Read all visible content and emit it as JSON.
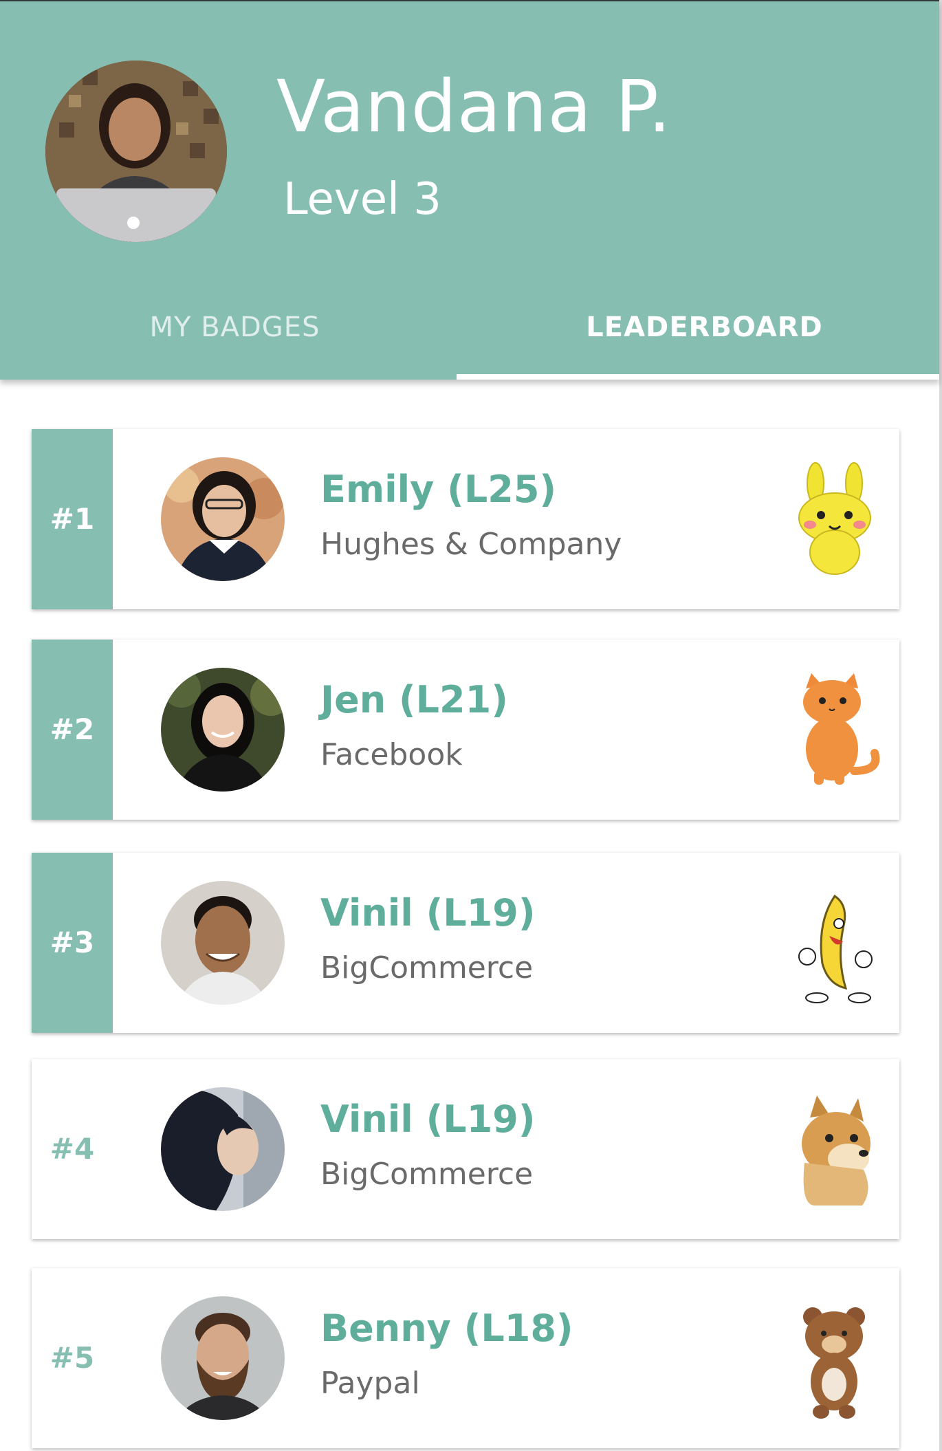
{
  "profile": {
    "name": "Vandana P.",
    "level": "Level 3",
    "avatar": "profile-photo"
  },
  "tabs": [
    {
      "label": "MY BADGES",
      "selected": false
    },
    {
      "label": "LEADERBOARD",
      "selected": true
    }
  ],
  "leaderboard": [
    {
      "rank": "#1",
      "name": "Emily (L25)",
      "company": "Hughes & Company",
      "sticker": "yellow-bunny-sticker",
      "highlighted": true
    },
    {
      "rank": "#2",
      "name": "Jen (L21)",
      "company": "Facebook",
      "sticker": "orange-cat-sticker",
      "highlighted": true
    },
    {
      "rank": "#3",
      "name": "Vinil (L19)",
      "company": "BigCommerce",
      "sticker": "dancing-banana-sticker",
      "highlighted": true
    },
    {
      "rank": "#4",
      "name": "Vinil (L19)",
      "company": "BigCommerce",
      "sticker": "doge-sticker",
      "highlighted": false
    },
    {
      "rank": "#5",
      "name": "Benny (L18)",
      "company": "Paypal",
      "sticker": "teddy-bear-sticker",
      "highlighted": false
    }
  ],
  "colors": {
    "accent": "#86bfb2",
    "name_text": "#5fae9b",
    "company_text": "#6a6a6a"
  }
}
